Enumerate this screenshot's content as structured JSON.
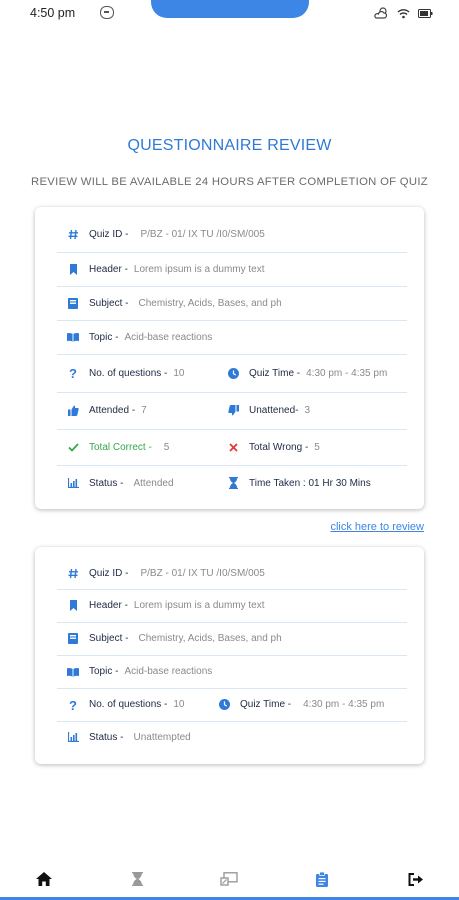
{
  "status_bar": {
    "time": "4:50 pm"
  },
  "page": {
    "title": "QUESTIONNAIRE REVIEW",
    "subtitle": "REVIEW WILL BE AVAILABLE 24 HOURS AFTER COMPLETION OF QUIZ"
  },
  "card1": {
    "quiz_id": {
      "label": "Quiz ID -",
      "value": "P/BZ - 01/ IX TU /I0/SM/005"
    },
    "header": {
      "label": "Header -",
      "value": "Lorem ipsum is a dummy text"
    },
    "subject": {
      "label": "Subject -",
      "value": "Chemistry, Acids, Bases, and ph"
    },
    "topic": {
      "label": "Topic -",
      "value": "Acid-base reactions"
    },
    "num_questions": {
      "label": "No. of questions -",
      "value": "10"
    },
    "quiz_time": {
      "label": "Quiz Time -",
      "value": "4:30 pm - 4:35 pm"
    },
    "attended": {
      "label": "Attended -",
      "value": "7"
    },
    "unattended": {
      "label": "Unattened-",
      "value": "3"
    },
    "total_correct": {
      "label": "Total Correct -",
      "value": "5"
    },
    "total_wrong": {
      "label": "Total Wrong -",
      "value": "5"
    },
    "status": {
      "label": "Status -",
      "value": "Attended"
    },
    "time_taken": {
      "label": "Time Taken : 01 Hr 30 Mins"
    }
  },
  "review_link": "click here to review",
  "card2": {
    "quiz_id": {
      "label": "Quiz ID -",
      "value": "P/BZ - 01/ IX TU /I0/SM/005"
    },
    "header": {
      "label": "Header -",
      "value": "Lorem ipsum is a dummy text"
    },
    "subject": {
      "label": "Subject -",
      "value": "Chemistry, Acids, Bases, and ph"
    },
    "topic": {
      "label": "Topic -",
      "value": "Acid-base reactions"
    },
    "num_questions": {
      "label": "No. of questions -",
      "value": "10"
    },
    "quiz_time": {
      "label": "Quiz Time -",
      "value": "4:30 pm - 4:35 pm"
    },
    "status": {
      "label": "Status -",
      "value": "Unattempted"
    }
  },
  "bottom_nav": [
    {
      "name": "home-icon",
      "active": false
    },
    {
      "name": "hourglass-icon",
      "active": false
    },
    {
      "name": "screen-share-icon",
      "active": false
    },
    {
      "name": "clipboard-icon",
      "active": true
    },
    {
      "name": "logout-icon",
      "active": false
    }
  ],
  "colors": {
    "accent": "#3d86e6",
    "title": "#2f7ad6",
    "correct": "#33a94a",
    "wrong": "#e53935"
  }
}
